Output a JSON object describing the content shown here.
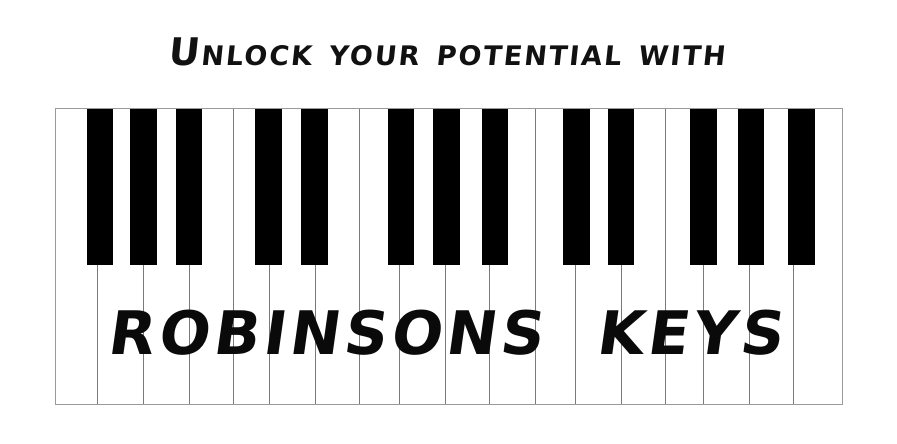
{
  "tagline": "Unlock your potential with",
  "brand_name": "ROBINSONS  KEYS",
  "colors": {
    "background": "#ffffff",
    "black_keys": "#000000",
    "key_outline": "#7a7a7a",
    "text": "#111111"
  },
  "icons": {
    "keyboard": "piano-keyboard-icon"
  }
}
